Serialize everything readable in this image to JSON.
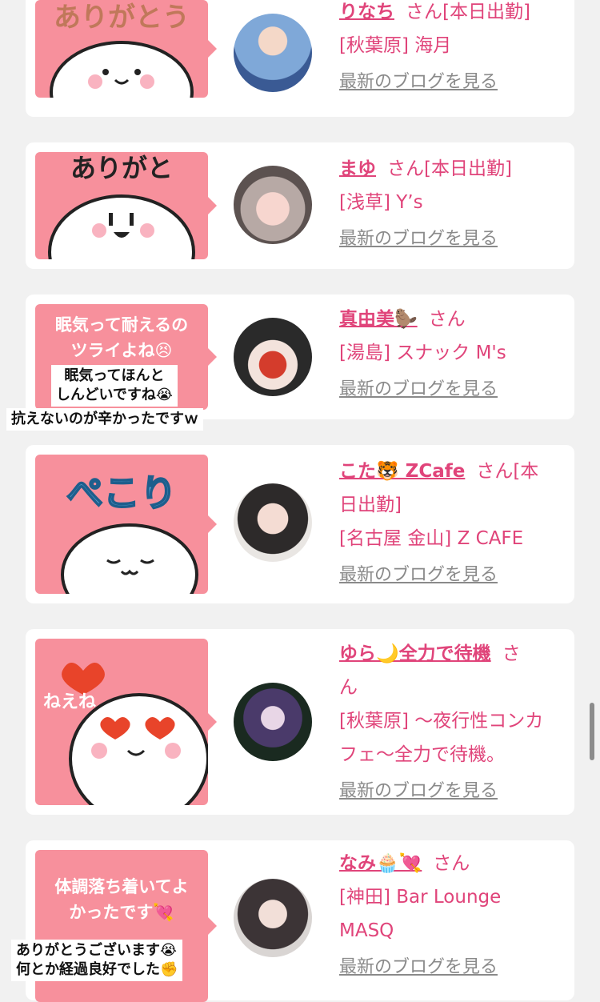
{
  "cards": [
    {
      "bubble_text": "ありがとう",
      "overlay_text": "",
      "name": "りなち",
      "honorific": "さん",
      "status": "[本日出勤]",
      "shop_line": "[秋葉原] 海月",
      "blog_link": "最新のブログを見る"
    },
    {
      "bubble_text": "ありがと",
      "overlay_text": "",
      "name": "まゆ",
      "honorific": "さん",
      "status": "[本日出勤]",
      "shop_line": "[浅草] Y’s",
      "blog_link": "最新のブログを見る"
    },
    {
      "bubble_text": "眠気って耐えるの\nツライよね😣",
      "overlay_text": "眠気ってほんと\nしんどいですね😭",
      "overlay_text_2": "抗えないのが辛かったですｗ",
      "name": "真由美🦫",
      "honorific": "さん",
      "status": "",
      "shop_line": "[湯島] スナック M's",
      "blog_link": "最新のブログを見る"
    },
    {
      "bubble_text": "ぺこり",
      "overlay_text": "",
      "name": "こた🐯 ZCafe",
      "honorific": "さん[本",
      "status": "日出勤]",
      "shop_line": "[名古屋 金山] Z CAFE",
      "blog_link": "最新のブログを見る"
    },
    {
      "bubble_text": "ねえね",
      "overlay_text": "",
      "name": "ゆら🌙全力で待機",
      "honorific": "さ",
      "status": "ん",
      "shop_line": "[秋葉原] 〜夜行性コンカ",
      "shop_line_2": "フェ〜全力で待機。",
      "blog_link": "最新のブログを見る"
    },
    {
      "bubble_text": "体調落ち着いてよ\nかったです💘",
      "overlay_text": "ありがとうございます😭\n何とか経過良好でした✊",
      "name": "なみ🧁💘",
      "honorific": "さん",
      "status": "",
      "shop_line": "[神田] Bar Lounge",
      "shop_line_2": "MASQ",
      "blog_link": "最新のブログを見る"
    }
  ],
  "colors": {
    "accent": "#e0447a",
    "bubble": "#f7909c",
    "link_gray": "#8a8a8a",
    "card_bg": "#ffffff",
    "page_bg": "#f1f1f1"
  }
}
